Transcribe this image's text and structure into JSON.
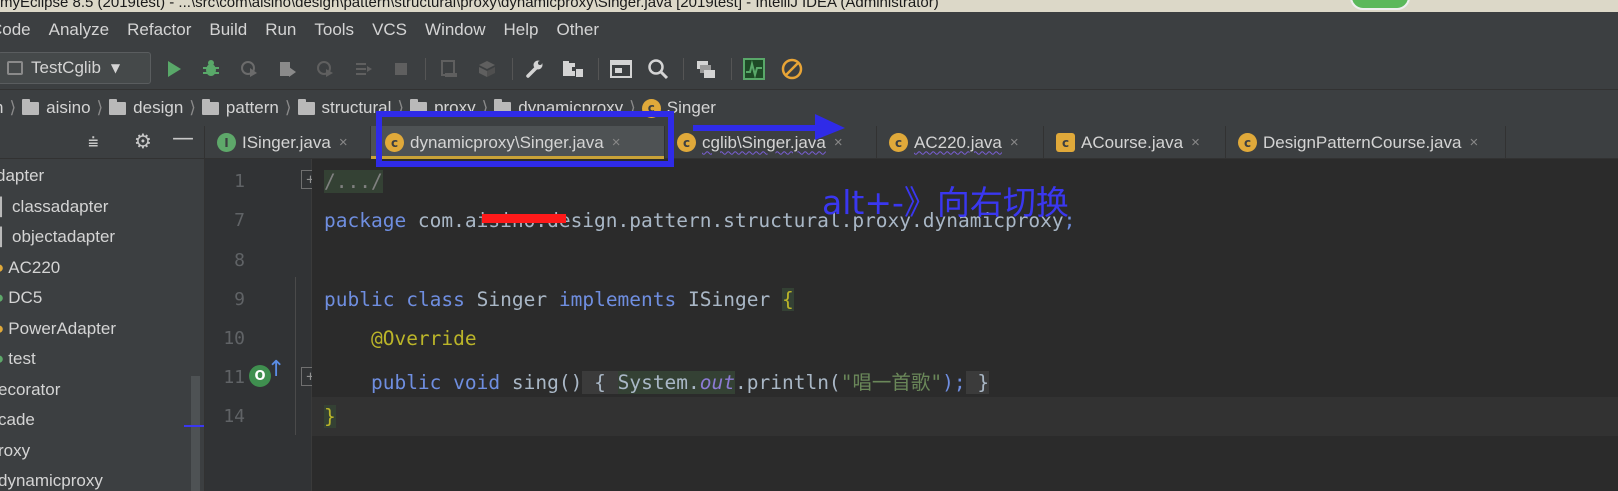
{
  "titlebar": {
    "text": "myEclipse 8.5 (2019test) - ...\\src\\com\\aisino\\design\\pattern\\structural\\proxy\\dynamicproxy\\Singer.java [2019test] - IntelliJ IDEA (Administrator)"
  },
  "menu": [
    "Code",
    "Analyze",
    "Refactor",
    "Build",
    "Run",
    "Tools",
    "VCS",
    "Window",
    "Help",
    "Other"
  ],
  "toolbar": {
    "run_config": "TestCglib"
  },
  "breadcrumb": {
    "items": [
      "n",
      "aisino",
      "design",
      "pattern",
      "structural",
      "proxy",
      "dynamicproxy",
      "Singer"
    ]
  },
  "project_tree": {
    "items": [
      "dapter",
      "classadapter",
      "objectadapter",
      "AC220",
      "DC5",
      "PowerAdapter",
      "test",
      "ecorator",
      "cade",
      "roxy",
      "dynamicproxy"
    ]
  },
  "tabs": [
    {
      "label": "ISinger.java",
      "icon": "interface-icon",
      "active": false
    },
    {
      "label": "dynamicproxy\\Singer.java",
      "icon": "class-icon",
      "active": true
    },
    {
      "label": "cglib\\Singer.java",
      "icon": "class-icon",
      "active": false
    },
    {
      "label": "AC220.java",
      "icon": "class-icon",
      "active": false
    },
    {
      "label": "ACourse.java",
      "icon": "abstract-class-icon",
      "active": false
    },
    {
      "label": "DesignPatternCourse.java",
      "icon": "class-icon",
      "active": false
    }
  ],
  "line_numbers": [
    "1",
    "7",
    "8",
    "9",
    "10",
    "11",
    "14"
  ],
  "code": {
    "l1": "/.../",
    "l7_kw": "package",
    "l7_pkg_a": " com.",
    "l7_pkg_hidden": "aisino",
    "l7_pkg_b": ".design.pattern.structural.proxy.dynamicproxy",
    "l7_semi": ";",
    "l9_public": "public",
    "l9_class": "class",
    "l9_name": "Singer",
    "l9_impl": "implements",
    "l9_iface": "ISinger",
    "l9_brace": "{",
    "l10_ann": "@Override",
    "l11_public": "public",
    "l11_void": "void",
    "l11_method": "sing()",
    "l11_open": "{",
    "l11_system": "System.",
    "l11_out": "out",
    "l11_println": ".println(",
    "l11_str": "\"唱一首歌\"",
    "l11_close": ");",
    "l11_end": "}",
    "l14": "}"
  },
  "annotation": {
    "text": "alt+-》向右切换"
  },
  "colors": {
    "annotation": "#3a37f0",
    "redaction": "#ff1a1a",
    "tab_active_underline": "#c9a237"
  }
}
